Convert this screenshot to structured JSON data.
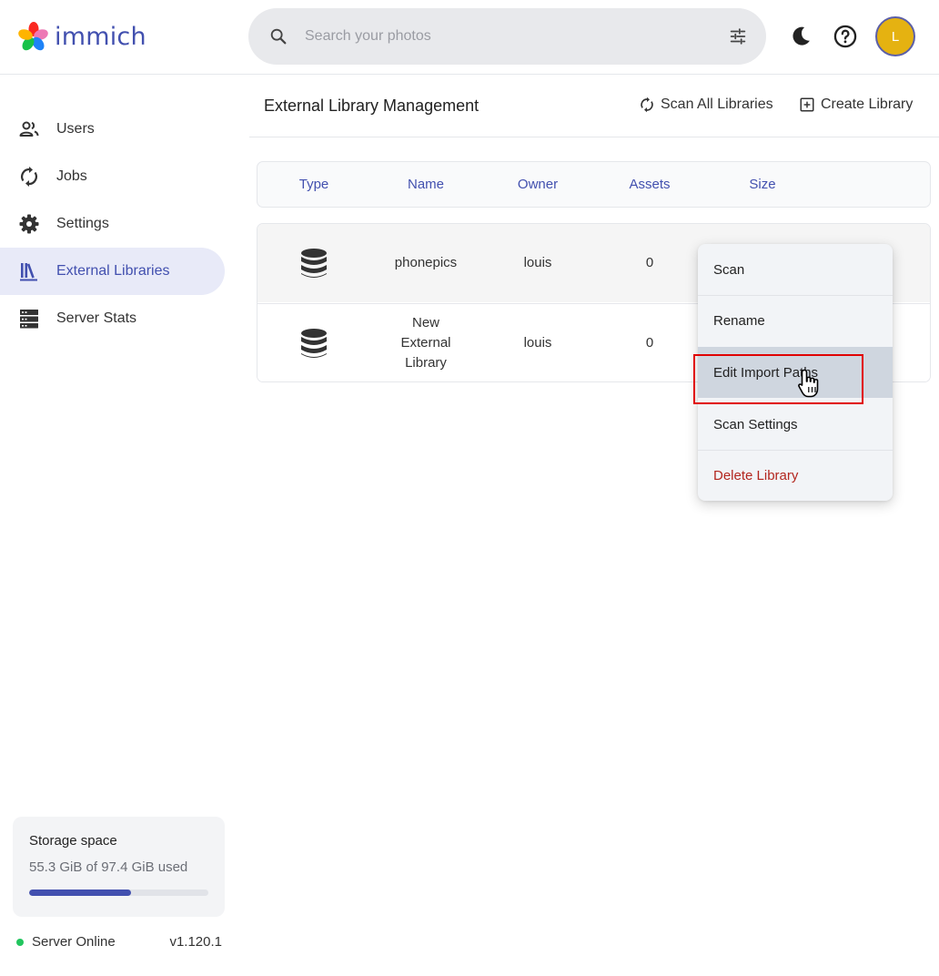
{
  "app": {
    "name": "immich"
  },
  "search": {
    "placeholder": "Search your photos"
  },
  "user": {
    "initial": "L"
  },
  "sidebar": {
    "items": [
      {
        "label": "Users",
        "icon": "users-icon"
      },
      {
        "label": "Jobs",
        "icon": "sync-icon"
      },
      {
        "label": "Settings",
        "icon": "gear-icon"
      },
      {
        "label": "External Libraries",
        "icon": "library-icon",
        "active": true
      },
      {
        "label": "Server Stats",
        "icon": "server-icon"
      }
    ],
    "storage": {
      "title": "Storage space",
      "used_text": "55.3 GiB of 97.4 GiB used",
      "fraction": 0.568
    },
    "status": {
      "label": "Server Online",
      "version": "v1.120.1"
    }
  },
  "main": {
    "title": "External Library Management",
    "scan_all_label": "Scan All Libraries",
    "create_label": "Create Library",
    "columns": [
      "Type",
      "Name",
      "Owner",
      "Assets",
      "Size"
    ],
    "rows": [
      {
        "name": "phonepics",
        "owner": "louis",
        "assets": "0"
      },
      {
        "name": "New External Library",
        "owner": "louis",
        "assets": "0"
      }
    ]
  },
  "menu": {
    "items": [
      "Scan",
      "Rename",
      "Edit Import Paths",
      "Scan Settings",
      "Delete Library"
    ]
  },
  "colors": {
    "accent": "#4250af",
    "danger": "#b3261e",
    "online": "#22c55e",
    "highlight": "#e00000"
  }
}
